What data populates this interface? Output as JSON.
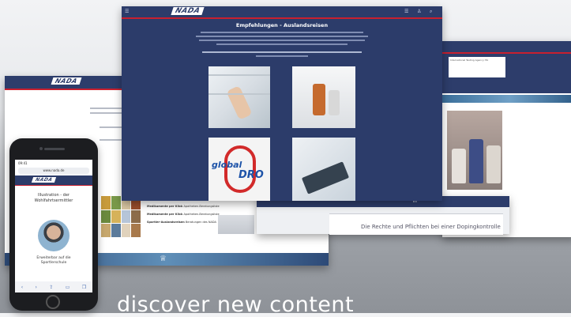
{
  "brand": {
    "logo_text": "NADA"
  },
  "main_screen": {
    "title": "Empfehlungen - Auslandsreisen",
    "body_lines": 4,
    "highlight_text": "",
    "global_dro_logo_text_1": "global",
    "global_dro_logo_text_2": "DRO",
    "icons": [
      "menu-icon",
      "user-icon",
      "search-icon"
    ]
  },
  "right_screen": {
    "note_text": "International Testing Agency ITA"
  },
  "left_screen": {
    "list_items": [
      {
        "title": "Medikamente per Klick",
        "subtitle": "Apotheken-Beratungsliste"
      },
      {
        "title": "Medikamente per Klick",
        "subtitle": "Apotheken-Beratungsliste"
      },
      {
        "title": "Sportler-Auslandsreisen",
        "subtitle": "Beratungen des NADA"
      }
    ]
  },
  "mid_screen": {
    "box_text": "Die Rechte und Pflichten bei einer Dopingkontrolle"
  },
  "phone": {
    "time": "09:41",
    "url": "www.nada.de",
    "title_line1": "Illustration - der",
    "title_line2": "Wohlfahrtsermittler",
    "caption_line1": "Erweiterbar auf die",
    "caption_line2": "Sportlerschule"
  },
  "slogan": "discover new content"
}
